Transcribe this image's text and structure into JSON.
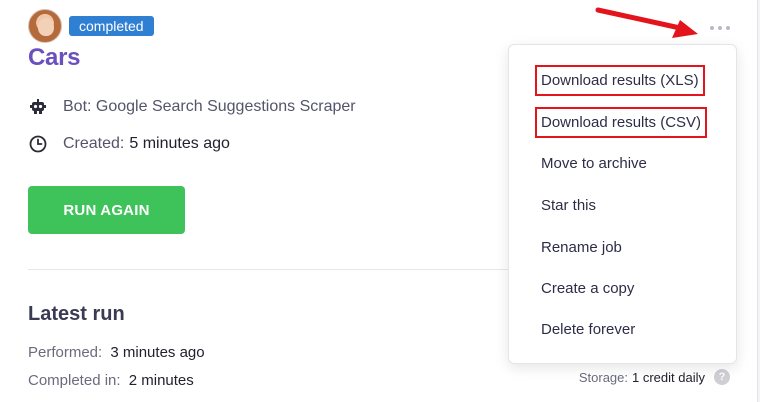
{
  "job": {
    "status_badge": "completed",
    "title": "Cars",
    "bot_label": "Bot: Google Search Suggestions Scraper",
    "created_label": "Created:",
    "created_value": "5 minutes ago",
    "run_again_label": "RUN AGAIN"
  },
  "latest_run": {
    "title": "Latest run",
    "performed_label": "Performed:",
    "performed_value": "3 minutes ago",
    "completed_label": "Completed in:",
    "completed_value": "2 minutes",
    "storage_label": "Storage:",
    "storage_value": "1 credit daily"
  },
  "menu": {
    "items": [
      "Download results (XLS)",
      "Download results (CSV)",
      "Move to archive",
      "Star this",
      "Rename job",
      "Create a copy",
      "Delete forever"
    ]
  },
  "icons": {
    "bot": "robot-icon",
    "created": "clock-icon",
    "more": "more-horizontal-icon",
    "help": "question-icon"
  },
  "colors": {
    "badge": "#2f7fd3",
    "title": "#6a4fbf",
    "run_button": "#3ec25a",
    "highlight": "#e3141c"
  }
}
